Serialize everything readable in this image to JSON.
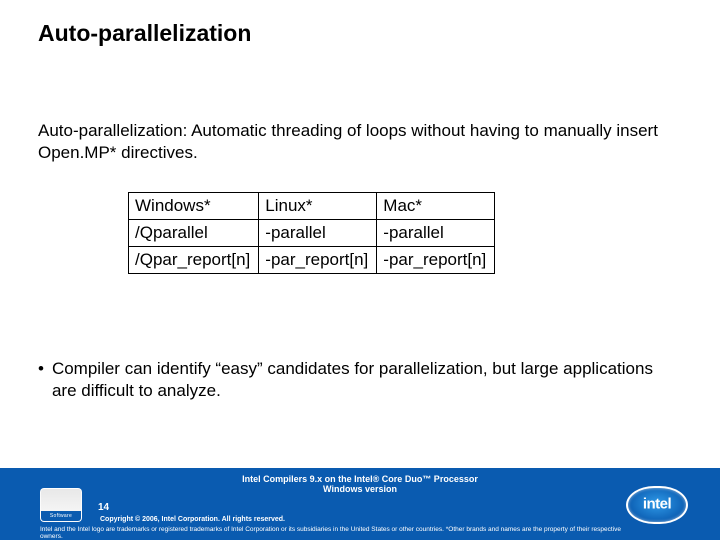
{
  "title": "Auto-parallelization",
  "description": "Auto-parallelization: Automatic threading of loops without having to manually insert Open.MP* directives.",
  "table": {
    "rows": [
      [
        "Windows*",
        "Linux*",
        "Mac*"
      ],
      [
        "/Qparallel",
        "-parallel",
        "-parallel"
      ],
      [
        "/Qpar_report[n]",
        "-par_report[n]",
        "-par_report[n]"
      ]
    ]
  },
  "bullet": "Compiler can identify “easy” candidates for parallelization, but large applications are difficult to analyze.",
  "footer": {
    "session_title_line1": "Intel Compilers 9.x on the Intel® Core Duo™ Processor",
    "session_title_line2": "Windows version",
    "page_number": "14",
    "software_label": "Software",
    "copyright": "Copyright © 2006, Intel Corporation. All rights reserved.",
    "legal": "Intel and the Intel logo are trademarks or registered trademarks of Intel Corporation or its subsidiaries in the United States or other countries. *Other brands and names are the property of their respective owners.",
    "logo_text": "intel"
  }
}
